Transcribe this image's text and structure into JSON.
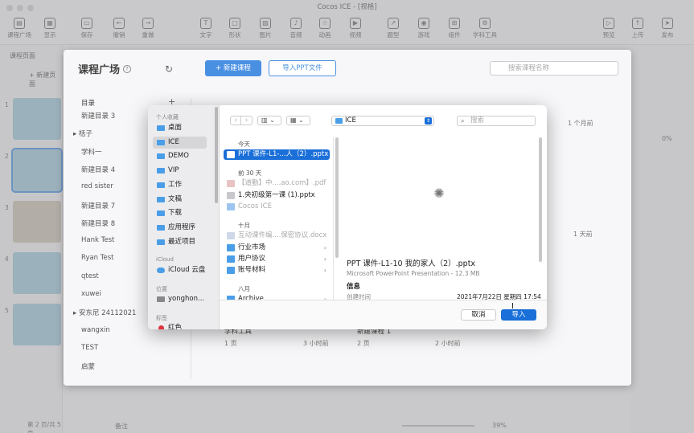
{
  "window_title": "Cocos ICE - [视格]",
  "toolbar": {
    "items": [
      {
        "label": "课程广场",
        "icon": "grid-icon",
        "glyph": "▤"
      },
      {
        "label": "显示",
        "icon": "display-icon",
        "glyph": "▦"
      },
      {
        "label": "保存",
        "icon": "save-icon",
        "glyph": "▭"
      },
      {
        "label": "撤销",
        "icon": "undo-icon",
        "glyph": "←"
      },
      {
        "label": "重做",
        "icon": "redo-icon",
        "glyph": "→"
      },
      {
        "label": "文字",
        "icon": "text-icon",
        "glyph": "T"
      },
      {
        "label": "形状",
        "icon": "shape-icon",
        "glyph": "□"
      },
      {
        "label": "图片",
        "icon": "image-icon",
        "glyph": "▨"
      },
      {
        "label": "音频",
        "icon": "microphone-icon",
        "glyph": "♪"
      },
      {
        "label": "动画",
        "icon": "animation-icon",
        "glyph": "☆"
      },
      {
        "label": "视频",
        "icon": "video-icon",
        "glyph": "▶"
      },
      {
        "label": "题型",
        "icon": "question-type-icon",
        "glyph": "↗"
      },
      {
        "label": "游戏",
        "icon": "game-icon",
        "glyph": "◉"
      },
      {
        "label": "组件",
        "icon": "component-icon",
        "glyph": "⊞"
      },
      {
        "label": "学科工具",
        "icon": "tools-icon",
        "glyph": "⚙"
      },
      {
        "label": "预览",
        "icon": "preview-icon",
        "glyph": "▷"
      },
      {
        "label": "上传",
        "icon": "upload-icon",
        "glyph": "↑"
      },
      {
        "label": "发布",
        "icon": "publish-icon",
        "glyph": "➤"
      }
    ]
  },
  "left_panel": {
    "header": "课程页面",
    "new_page": "+ 新建页面",
    "slide_numbers": [
      "1",
      "2",
      "3",
      "4",
      "5"
    ],
    "footer": "第 2 页/共 5 页"
  },
  "course_square": {
    "title": "课程广场",
    "new_course_button": "+ 新建课程",
    "import_ppt_button": "导入PPT文件",
    "search_placeholder": "搜索课程名称",
    "dir_header": "目录",
    "dir_add": "+",
    "directories": [
      "新建目录 3",
      "▸  栝子",
      "学科一",
      "新建目录 4",
      "red sister",
      "新建目录 7",
      "新建目录 8",
      "Hank Test",
      "Ryan Test",
      "qtest",
      "xuwei",
      "▸  安东尼 24112021",
      "wangxin",
      "TEST",
      "启蒙"
    ],
    "card_times": [
      "1 个月前",
      "1 天前"
    ],
    "cards_bottom": [
      {
        "name": "学科工具",
        "pages": "1 页",
        "time": "3 小时前"
      },
      {
        "name": "新建课程 1",
        "pages": "2 页",
        "time": "2 小时前"
      }
    ],
    "zoom_percent": "0%",
    "zoom_footer": "39%",
    "notes_label": "备注"
  },
  "dialog": {
    "toolbar": {
      "location": "ICE",
      "search_placeholder": "搜索"
    },
    "sidebar": {
      "favorites_header": "个人收藏",
      "favorites": [
        "桌面",
        "ICE",
        "DEMO",
        "VIP",
        "工作",
        "文稿",
        "下载",
        "应用程序",
        "最近项目"
      ],
      "icloud_header": "iCloud",
      "icloud": [
        "iCloud 云盘"
      ],
      "locations_header": "位置",
      "locations": [
        "yonghon..."
      ],
      "tags_header": "标签",
      "tags": [
        "红色"
      ]
    },
    "file_list": {
      "groups": [
        {
          "header": "今天",
          "files": [
            {
              "name": "PPT 课件-L1-...人（2）.pptx",
              "type": "ppt",
              "selected": true,
              "dim": false,
              "folder": false
            }
          ]
        },
        {
          "header": "前 30 天",
          "files": [
            {
              "name": "【道勤】中....ao.com】.pdf",
              "type": "pdf",
              "selected": false,
              "dim": true,
              "folder": false
            },
            {
              "name": "1.央初级第一课 (1).pptx",
              "type": "ppt",
              "selected": false,
              "dim": false,
              "folder": false
            },
            {
              "name": "Cocos ICE",
              "type": "app",
              "selected": false,
              "dim": true,
              "folder": false
            }
          ]
        },
        {
          "header": "十月",
          "files": [
            {
              "name": "互动课件编....保密协议.docx",
              "type": "doc",
              "selected": false,
              "dim": true,
              "folder": false
            },
            {
              "name": "行业市场",
              "type": "folder",
              "selected": false,
              "dim": false,
              "folder": true
            },
            {
              "name": "用户协议",
              "type": "folder",
              "selected": false,
              "dim": false,
              "folder": true
            },
            {
              "name": "账号材料",
              "type": "folder",
              "selected": false,
              "dim": false,
              "folder": true
            }
          ]
        },
        {
          "header": "八月",
          "files": [
            {
              "name": "Archive",
              "type": "folder",
              "selected": false,
              "dim": false,
              "folder": true
            }
          ]
        }
      ]
    },
    "preview": {
      "title": "PPT 课件-L1-10 我的家人（2）.pptx",
      "subtitle": "Microsoft PowerPoint Presentation - 12.3 MB",
      "info_header": "信息",
      "created_label": "创建时间",
      "created_value": "2021年7月22日 星期四 17:54"
    },
    "cancel_label": "取消",
    "import_label": "导入"
  },
  "colors": {
    "accent": "#1a6fd8",
    "folder": "#4a9ee8",
    "tag_red": "#e0303a"
  }
}
